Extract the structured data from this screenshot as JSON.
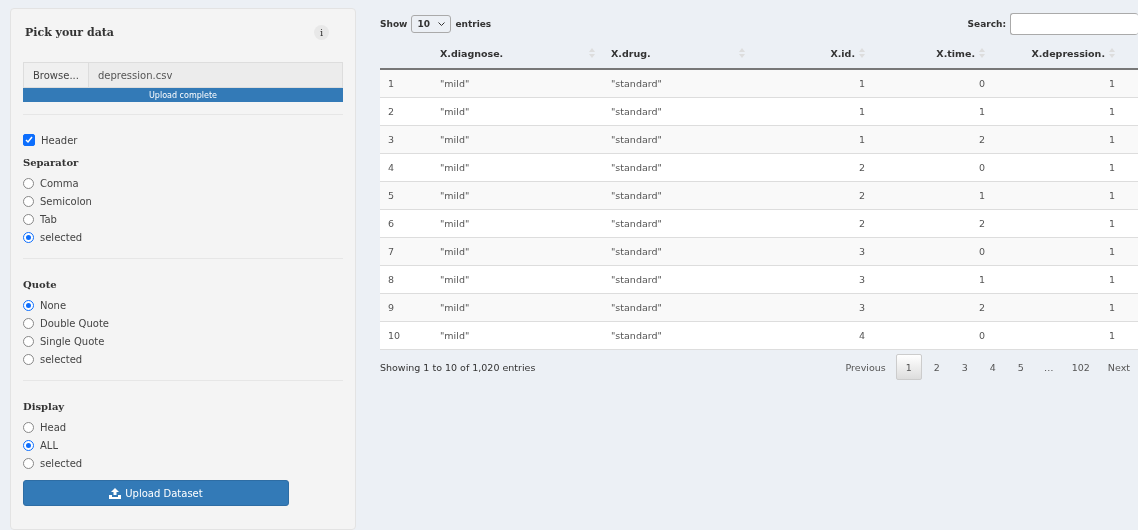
{
  "sidebar": {
    "title": "Pick your data",
    "info_icon": "i",
    "file_input": {
      "button": "Browse...",
      "value": "depression.csv",
      "progress": {
        "label": "Upload complete",
        "level": 1
      }
    },
    "header_checkbox": {
      "label": "Header",
      "checked": true
    },
    "groups": [
      {
        "title": "Separator",
        "options": [
          {
            "label": "Comma",
            "selected": false
          },
          {
            "label": "Semicolon",
            "selected": false
          },
          {
            "label": "Tab",
            "selected": false
          },
          {
            "label": "selected",
            "selected": true
          }
        ]
      },
      {
        "title": "Quote",
        "options": [
          {
            "label": "None",
            "selected": true
          },
          {
            "label": "Double Quote",
            "selected": false
          },
          {
            "label": "Single Quote",
            "selected": false
          },
          {
            "label": "selected",
            "selected": false
          }
        ]
      },
      {
        "title": "Display",
        "options": [
          {
            "label": "Head",
            "selected": false
          },
          {
            "label": "ALL",
            "selected": true
          },
          {
            "label": "selected",
            "selected": false
          }
        ]
      }
    ],
    "upload_button": "Upload Dataset"
  },
  "table": {
    "show_label": "Show",
    "page_size": "10",
    "entries_label": "entries",
    "search_label": "Search:",
    "columns": [
      "",
      "X.diagnose.",
      "X.drug.",
      "X.id.",
      "X.time.",
      "X.depression."
    ],
    "rows": [
      [
        "1",
        "\"mild\"",
        "\"standard\"",
        "1",
        "0",
        "1"
      ],
      [
        "2",
        "\"mild\"",
        "\"standard\"",
        "1",
        "1",
        "1"
      ],
      [
        "3",
        "\"mild\"",
        "\"standard\"",
        "1",
        "2",
        "1"
      ],
      [
        "4",
        "\"mild\"",
        "\"standard\"",
        "2",
        "0",
        "1"
      ],
      [
        "5",
        "\"mild\"",
        "\"standard\"",
        "2",
        "1",
        "1"
      ],
      [
        "6",
        "\"mild\"",
        "\"standard\"",
        "2",
        "2",
        "1"
      ],
      [
        "7",
        "\"mild\"",
        "\"standard\"",
        "3",
        "0",
        "1"
      ],
      [
        "8",
        "\"mild\"",
        "\"standard\"",
        "3",
        "1",
        "1"
      ],
      [
        "9",
        "\"mild\"",
        "\"standard\"",
        "3",
        "2",
        "1"
      ],
      [
        "10",
        "\"mild\"",
        "\"standard\"",
        "4",
        "0",
        "1"
      ]
    ],
    "info": "Showing 1 to 10 of 1,020 entries",
    "pagination": [
      {
        "label": "Previous",
        "selected": false
      },
      {
        "label": "1",
        "selected": true
      },
      {
        "label": "2",
        "selected": false
      },
      {
        "label": "3",
        "selected": false
      },
      {
        "label": "4",
        "selected": false
      },
      {
        "label": "5",
        "selected": false
      },
      {
        "label": "…",
        "selected": false
      },
      {
        "label": "102",
        "selected": false
      },
      {
        "label": "Next",
        "selected": false
      }
    ]
  }
}
